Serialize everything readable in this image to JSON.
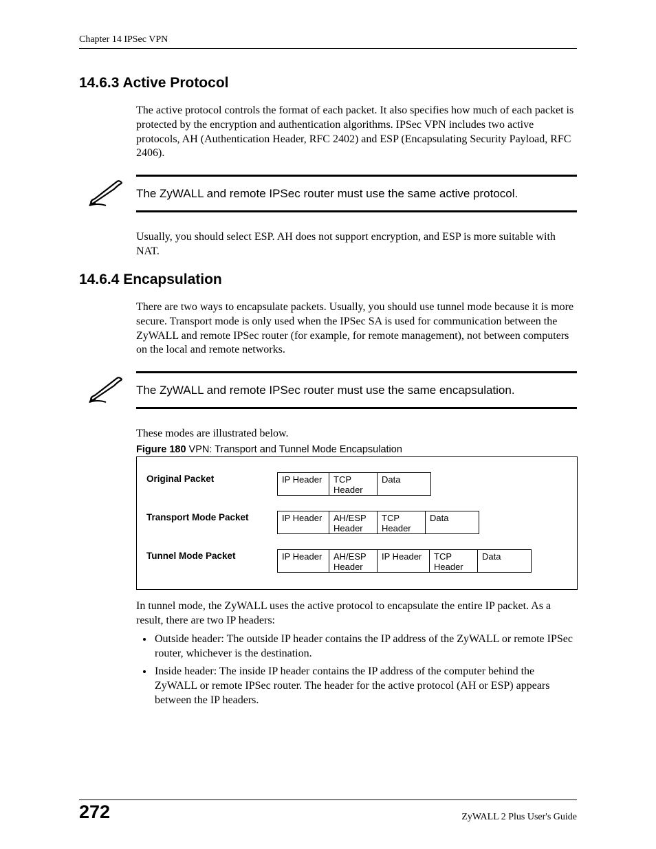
{
  "header": {
    "chapter_line": "Chapter 14 IPSec VPN"
  },
  "sections": {
    "s1": {
      "heading": "14.6.3  Active Protocol",
      "para1": "The active protocol controls the format of each packet. It also specifies how much of each packet is protected by the encryption and authentication algorithms. IPSec VPN includes two active protocols, AH (Authentication Header, RFC 2402) and ESP (Encapsulating Security Payload, RFC 2406).",
      "note": "The ZyWALL and remote IPSec router must use the same active protocol.",
      "para2": "Usually, you should select ESP. AH does not support encryption, and ESP is more suitable with NAT."
    },
    "s2": {
      "heading": "14.6.4  Encapsulation",
      "para1": "There are two ways to encapsulate packets. Usually, you should use tunnel mode because it is more secure. Transport mode is only used when the IPSec SA is used for communication between the ZyWALL and remote IPSec router (for example, for remote management), not between computers on the local and remote networks.",
      "note": "The ZyWALL and remote IPSec router must use the same encapsulation.",
      "para2": "These modes are illustrated below.",
      "fig_num": "Figure 180",
      "fig_title": "   VPN: Transport and Tunnel Mode Encapsulation",
      "para3": "In tunnel mode, the ZyWALL uses the active protocol to encapsulate the entire IP packet. As a result, there are two IP headers:",
      "bullet1": "Outside header: The outside IP header contains the IP address of the ZyWALL or remote IPSec router, whichever is the destination.",
      "bullet2": "Inside header: The inside IP header contains the IP address of the computer behind the ZyWALL or remote IPSec router. The header for the active protocol (AH or ESP) appears between the IP headers."
    }
  },
  "figure": {
    "rows": [
      {
        "label": "Original Packet",
        "cells": [
          "IP Header",
          "TCP\nHeader",
          "Data"
        ]
      },
      {
        "label": "Transport Mode Packet",
        "cells": [
          "IP Header",
          "AH/ESP\nHeader",
          "TCP\nHeader",
          "Data"
        ]
      },
      {
        "label": "Tunnel Mode Packet",
        "cells": [
          "IP Header",
          "AH/ESP\nHeader",
          "IP Header",
          "TCP\nHeader",
          "Data"
        ]
      }
    ]
  },
  "footer": {
    "page": "272",
    "guide": "ZyWALL 2 Plus User's Guide"
  }
}
